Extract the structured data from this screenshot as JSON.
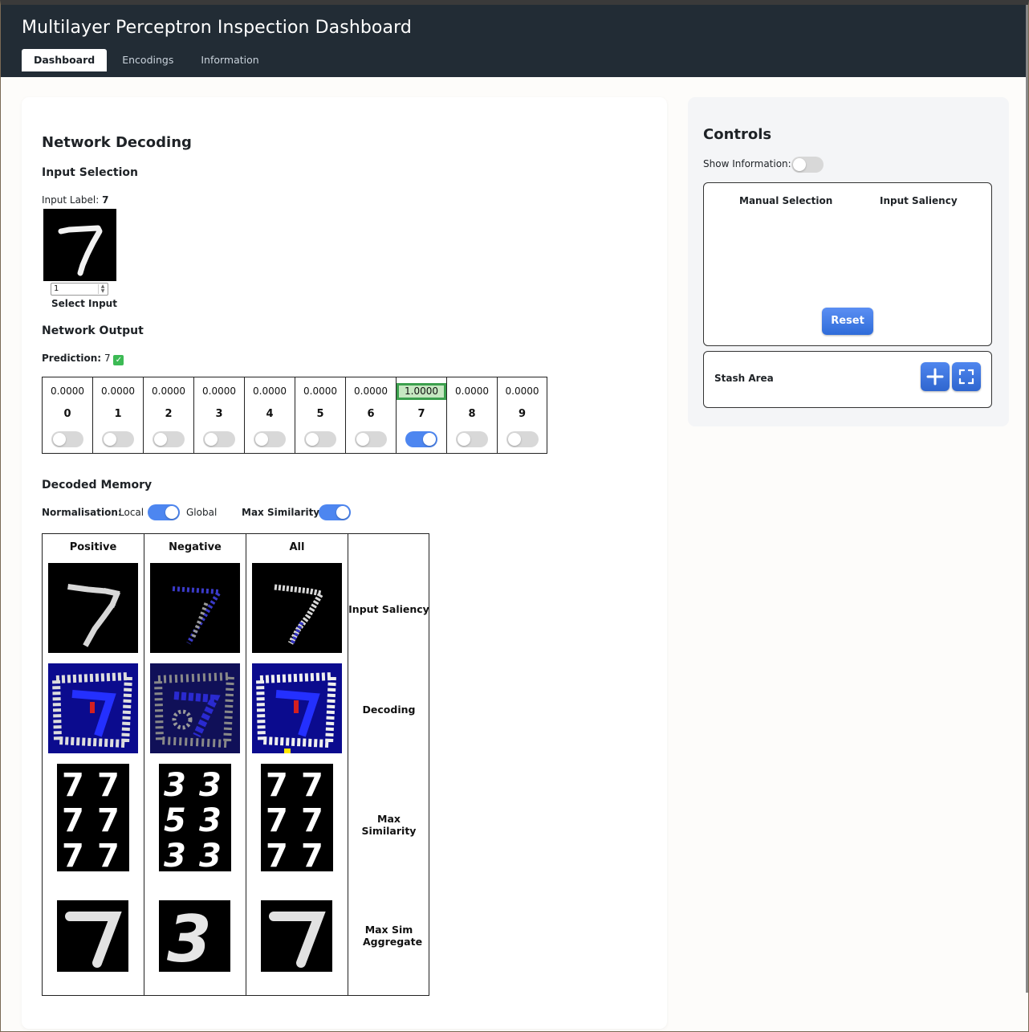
{
  "header": {
    "title": "Multilayer Perceptron Inspection Dashboard",
    "tabs": [
      {
        "label": "Dashboard",
        "active": true
      },
      {
        "label": "Encodings",
        "active": false
      },
      {
        "label": "Information",
        "active": false
      }
    ]
  },
  "main": {
    "title": "Network Decoding",
    "input_selection": {
      "heading": "Input Selection",
      "label_prefix": "Input Label:",
      "label_value": "7",
      "spinner_value": "1",
      "select_label": "Select Input"
    },
    "network_output": {
      "heading": "Network Output",
      "prediction_label": "Prediction:",
      "prediction_value": "7",
      "prediction_correct_icon": "check-icon",
      "outputs": [
        {
          "value": "0.0000",
          "label": "0",
          "selected": false
        },
        {
          "value": "0.0000",
          "label": "1",
          "selected": false
        },
        {
          "value": "0.0000",
          "label": "2",
          "selected": false
        },
        {
          "value": "0.0000",
          "label": "3",
          "selected": false
        },
        {
          "value": "0.0000",
          "label": "4",
          "selected": false
        },
        {
          "value": "0.0000",
          "label": "5",
          "selected": false
        },
        {
          "value": "0.0000",
          "label": "6",
          "selected": false
        },
        {
          "value": "1.0000",
          "label": "7",
          "selected": true
        },
        {
          "value": "0.0000",
          "label": "8",
          "selected": false
        },
        {
          "value": "0.0000",
          "label": "9",
          "selected": false
        }
      ]
    },
    "decoded_memory": {
      "heading": "Decoded Memory",
      "normalisation_label": "Normalisation:",
      "normalisation_left": "Local",
      "normalisation_right": "Global",
      "normalisation_global": true,
      "max_similarity_label": "Max Similarity:",
      "max_similarity_on": true,
      "columns": [
        "Positive",
        "Negative",
        "All"
      ],
      "rows": [
        "Input Saliency",
        "Decoding",
        "Max Similarity",
        "Max Sim Aggregate"
      ],
      "max_similarity_digits": {
        "Positive": [
          "7",
          "7",
          "7",
          "7",
          "7",
          "7"
        ],
        "Negative": [
          "3",
          "3",
          "5",
          "3",
          "3",
          "3"
        ],
        "All": [
          "7",
          "7",
          "7",
          "7",
          "7",
          "7"
        ]
      },
      "aggregate_digits": {
        "Positive": "7",
        "Negative": "3",
        "All": "7"
      }
    }
  },
  "controls": {
    "title": "Controls",
    "show_information_label": "Show Information:",
    "show_information_on": false,
    "manual_selection_label": "Manual Selection",
    "input_saliency_label": "Input Saliency",
    "reset_label": "Reset",
    "stash_area_label": "Stash Area",
    "stash_add_icon": "plus-icon",
    "stash_expand_icon": "fullscreen-icon"
  },
  "colors": {
    "header_bg": "#222c35",
    "accent": "#4d86f0",
    "highlight_bg": "#c6e7c1",
    "highlight_border": "#3ca04e"
  }
}
